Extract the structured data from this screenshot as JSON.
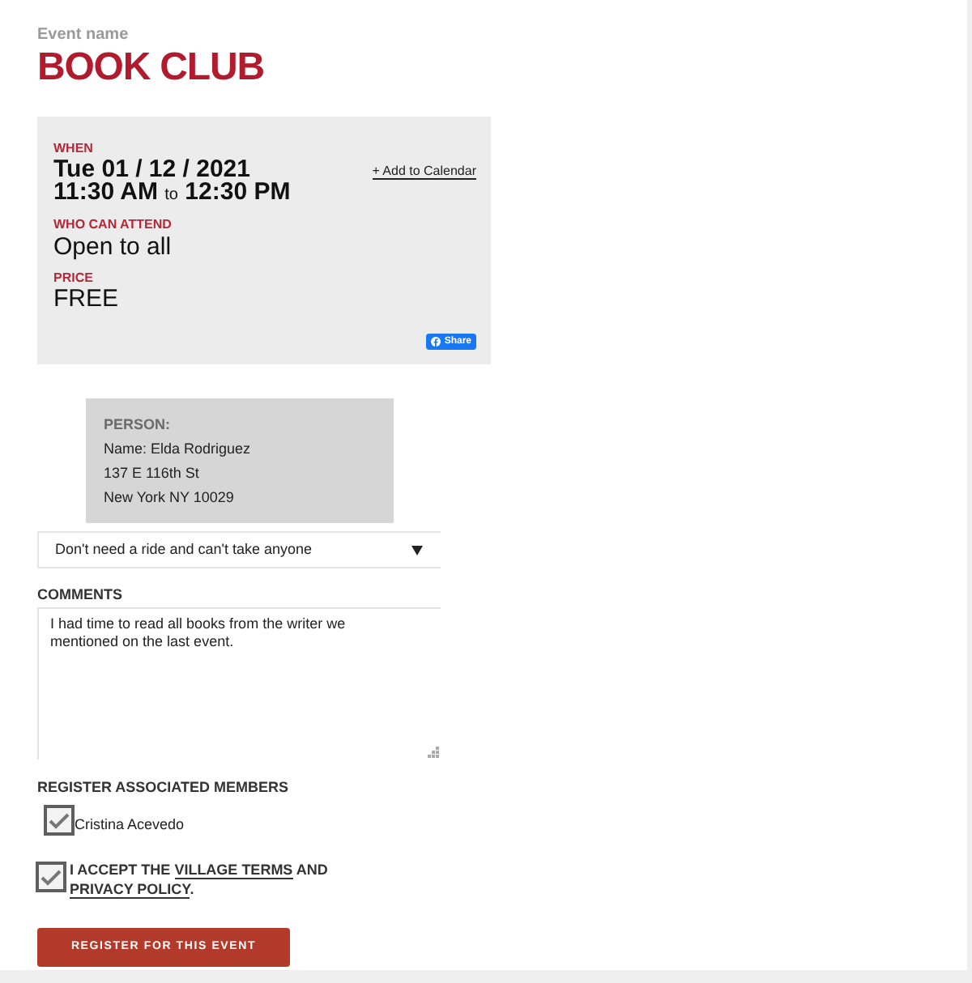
{
  "event": {
    "label": "Event name",
    "title": "BOOK CLUB"
  },
  "details": {
    "when_label": "WHEN",
    "date": "Tue 01 / 12 / 2021",
    "start_time": "11:30 AM",
    "time_separator": "to",
    "end_time": "12:30 PM",
    "add_to_calendar": "+ Add to Calendar",
    "attendance_label": "WHO CAN ATTEND",
    "attendance": "Open to all",
    "price_label": "PRICE",
    "price": "FREE",
    "share_button": "Share"
  },
  "person": {
    "heading": "PERSON:",
    "lines": [
      "Name: Elda Rodriguez",
      "137 E 116th St",
      "New York NY 10029"
    ]
  },
  "ride_select": {
    "value": "Don't need a ride and can't take anyone"
  },
  "comments": {
    "label": "COMMENTS",
    "value": "I had time to read all books from the writer we mentioned on the last event."
  },
  "members": {
    "label": "REGISTER ASSOCIATED MEMBERS",
    "items": [
      {
        "name": "Cristina Acevedo",
        "checked": true
      }
    ]
  },
  "terms": {
    "checked": true,
    "text_before": "I ACCEPT THE",
    "terms_link": "VILLAGE TERMS",
    "text_between": "AND",
    "privacy_link": "PRIVACY POLICY",
    "text_after": "."
  },
  "submit_button": "REGISTER FOR THIS EVENT"
}
